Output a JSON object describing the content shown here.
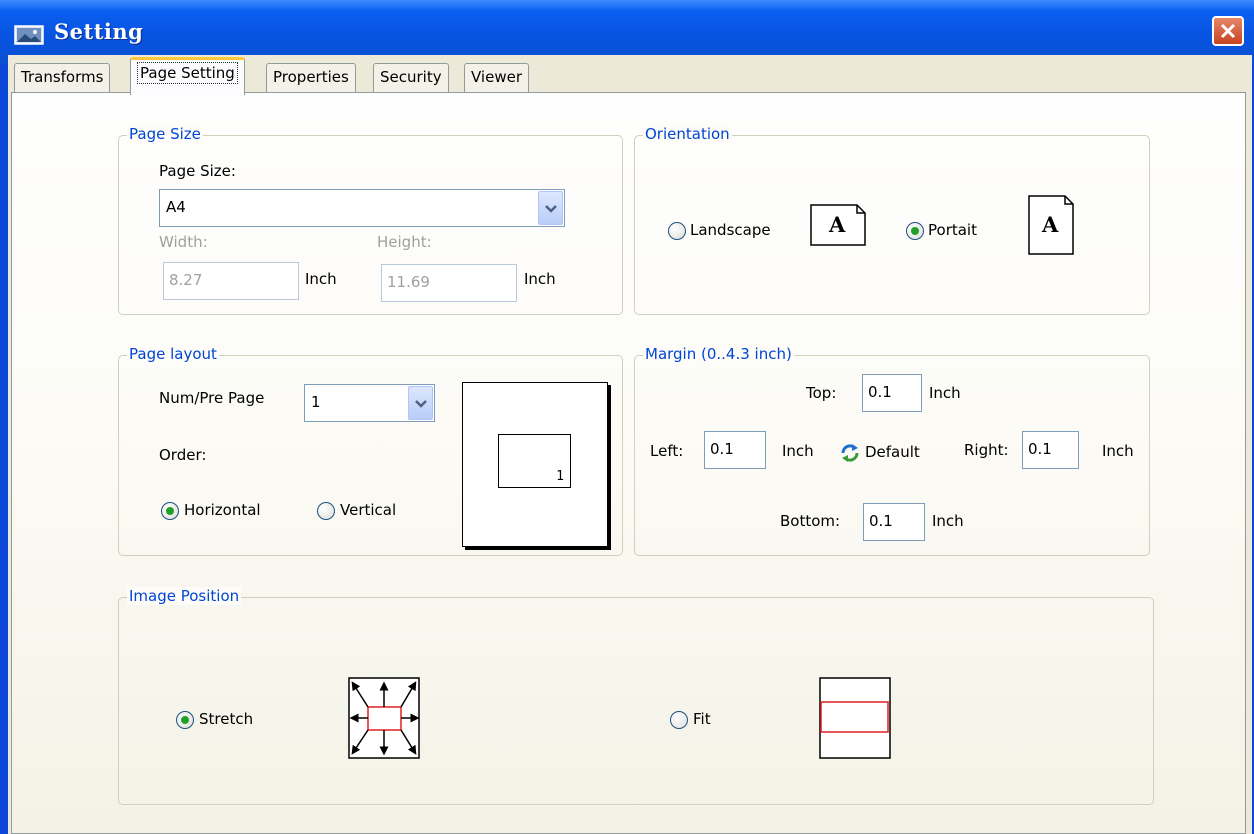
{
  "window": {
    "title": "Setting"
  },
  "tabs": [
    {
      "label": "Transforms",
      "active": false
    },
    {
      "label": "Page Setting",
      "active": true
    },
    {
      "label": "Properties",
      "active": false
    },
    {
      "label": "Security",
      "active": false
    },
    {
      "label": "Viewer",
      "active": false
    }
  ],
  "page_size": {
    "group_title": "Page Size",
    "label": "Page Size:",
    "selected": "A4",
    "width_label": "Width:",
    "width_value": "8.27",
    "height_label": "Height:",
    "height_value": "11.69",
    "unit": "Inch"
  },
  "orientation": {
    "group_title": "Orientation",
    "landscape_label": "Landscape",
    "portrait_label": "Portait",
    "selected": "portrait",
    "preview_letter": "A"
  },
  "page_layout": {
    "group_title": "Page layout",
    "num_label": "Num/Pre Page",
    "num_value": "1",
    "order_label": "Order:",
    "horizontal_label": "Horizontal",
    "vertical_label": "Vertical",
    "selected_order": "horizontal",
    "preview_number": "1"
  },
  "margin": {
    "group_title": "Margin (0..4.3 inch)",
    "top_label": "Top:",
    "top_value": "0.1",
    "left_label": "Left:",
    "left_value": "0.1",
    "right_label": "Right:",
    "right_value": "0.1",
    "bottom_label": "Bottom:",
    "bottom_value": "0.1",
    "unit": "Inch",
    "default_label": "Default"
  },
  "image_position": {
    "group_title": "Image Position",
    "stretch_label": "Stretch",
    "fit_label": "Fit",
    "selected": "stretch"
  },
  "colors": {
    "title_bar": "#0a5ef0",
    "group_title": "#0046d5",
    "radio_dot": "#20a02a",
    "active_tab_accent": "#ffc83c",
    "preview_rect": "#e02020"
  },
  "icons": [
    "window-app-icon",
    "close-icon",
    "chevron-down-icon",
    "refresh-default-icon",
    "page-landscape-icon",
    "page-portrait-icon",
    "stretch-arrows-icon",
    "fit-preview-icon"
  ]
}
